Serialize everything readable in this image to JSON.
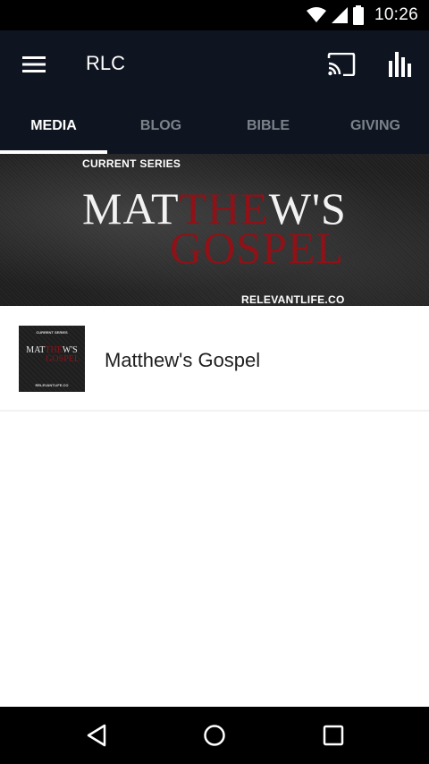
{
  "status_bar": {
    "time": "10:26",
    "icons": [
      "wifi-icon",
      "signal-icon",
      "battery-icon"
    ]
  },
  "app_bar": {
    "title": "RLC",
    "icons": [
      "menu-icon",
      "cast-icon",
      "equalizer-icon"
    ]
  },
  "tabs": [
    {
      "label": "MEDIA",
      "active": true
    },
    {
      "label": "BLOG",
      "active": false
    },
    {
      "label": "BIBLE",
      "active": false
    },
    {
      "label": "GIVING",
      "active": false
    }
  ],
  "banner": {
    "kicker": "CURRENT SERIES",
    "title_part1": "MAT",
    "title_part2_red": "THE",
    "title_part3": "W'S",
    "title_line2": "GOSPEL",
    "site": "RELEVANTLIFE.CO"
  },
  "thumbnail": {
    "kicker": "CURRENT SERIES",
    "title_part1": "MAT",
    "title_part2_red": "THE",
    "title_part3": "W'S",
    "title_line2": "GOSPEL",
    "site": "RELEVANTLIFE.CO"
  },
  "series_list": [
    {
      "title": "Matthew's Gospel"
    }
  ],
  "nav_bar": {
    "icons": [
      "back-icon",
      "home-icon",
      "recents-icon"
    ]
  },
  "colors": {
    "app_bar_bg": "#0e1520",
    "status_bar_bg": "#000000",
    "accent_red": "#8e1218",
    "tab_inactive": "#7c828a",
    "tab_active": "#ffffff"
  }
}
